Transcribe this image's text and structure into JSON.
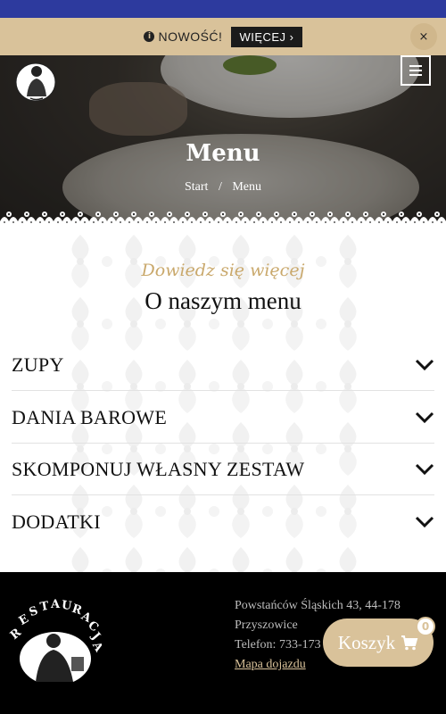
{
  "notice": {
    "info_icon": "info-circle-icon",
    "text": "NOWOŚĆ!",
    "more_label": "WIĘCEJ ›",
    "close_label": "×"
  },
  "hero": {
    "title": "Menu",
    "breadcrumb": [
      "Start",
      "/",
      "Menu"
    ]
  },
  "intro": {
    "kicker": "Dowiedz się więcej",
    "heading": "O naszym menu"
  },
  "menu_sections": [
    {
      "label": "ZUPY"
    },
    {
      "label": "DANIA BAROWE"
    },
    {
      "label": "SKOMPONUJ WŁASNY ZESTAW"
    },
    {
      "label": "DODATKI"
    }
  ],
  "footer": {
    "address_line1": "Powstańców Śląskich 43, 44-178",
    "address_line2": "Przyszowice",
    "phone": "Telefon: 733-173",
    "map_link": "Mapa dojazdu"
  },
  "cart": {
    "label": "Koszyk",
    "count": "0"
  },
  "colors": {
    "topbar": "#2d3a9e",
    "notice_bg": "#d9c29a",
    "gold": "#c9a86b"
  }
}
